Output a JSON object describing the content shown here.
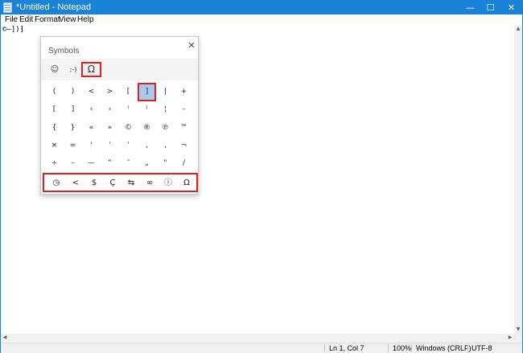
{
  "window": {
    "title": "*Untitled - Notepad",
    "controls": {
      "minimize": "—",
      "maximize": "☐",
      "close": "✕"
    }
  },
  "menu": [
    "File",
    "Edit",
    "Format",
    "View",
    "Help"
  ],
  "editor": {
    "text": "©—])⁆"
  },
  "statusbar": {
    "position": "Ln 1, Col 7",
    "zoom": "100%",
    "line_ending": "Windows (CRLF)",
    "encoding": "UTF-8"
  },
  "symbols_panel": {
    "title": "Symbols",
    "close": "✕",
    "tabs": [
      {
        "icon": "smiley-icon",
        "label": "☺"
      },
      {
        "icon": "kaomoji-icon",
        "label": ";-)"
      },
      {
        "icon": "omega-icon",
        "label": "Ω",
        "selected": true
      }
    ],
    "grid": [
      [
        "!",
        "?",
        "@",
        "#",
        "{",
        "}",
        "%",
        "&"
      ],
      [
        "(",
        ")",
        "<",
        ">",
        "[",
        "]",
        "|",
        "+"
      ],
      [
        "[",
        "]",
        "‹",
        "›",
        "⁽",
        "⁾",
        "¦",
        "-"
      ],
      [
        "{",
        "}",
        "«",
        "»",
        "©",
        "®",
        "℗",
        "™"
      ],
      [
        "×",
        "=",
        "‘",
        "’",
        "‛",
        ",",
        "‚",
        "¬"
      ],
      [
        "÷",
        "–",
        "—",
        "‟",
        "″",
        "„",
        "\"",
        "/"
      ]
    ],
    "selected_symbol": "]",
    "categories": [
      {
        "icon": "history-icon",
        "label": "◷"
      },
      {
        "icon": "punctuation-icon",
        "label": "<"
      },
      {
        "icon": "currency-icon",
        "label": "$"
      },
      {
        "icon": "latin-icon",
        "label": "Ç"
      },
      {
        "icon": "geometric-icon",
        "label": "⇆"
      },
      {
        "icon": "math-icon",
        "label": "∞"
      },
      {
        "icon": "supplemental-icon",
        "label": "ⓘ"
      },
      {
        "icon": "language-icon",
        "label": "Ω"
      }
    ]
  },
  "colors": {
    "titlebar": "#1883d7",
    "highlight_border": "#e02020",
    "selected_cell": "#a8c9ec"
  }
}
